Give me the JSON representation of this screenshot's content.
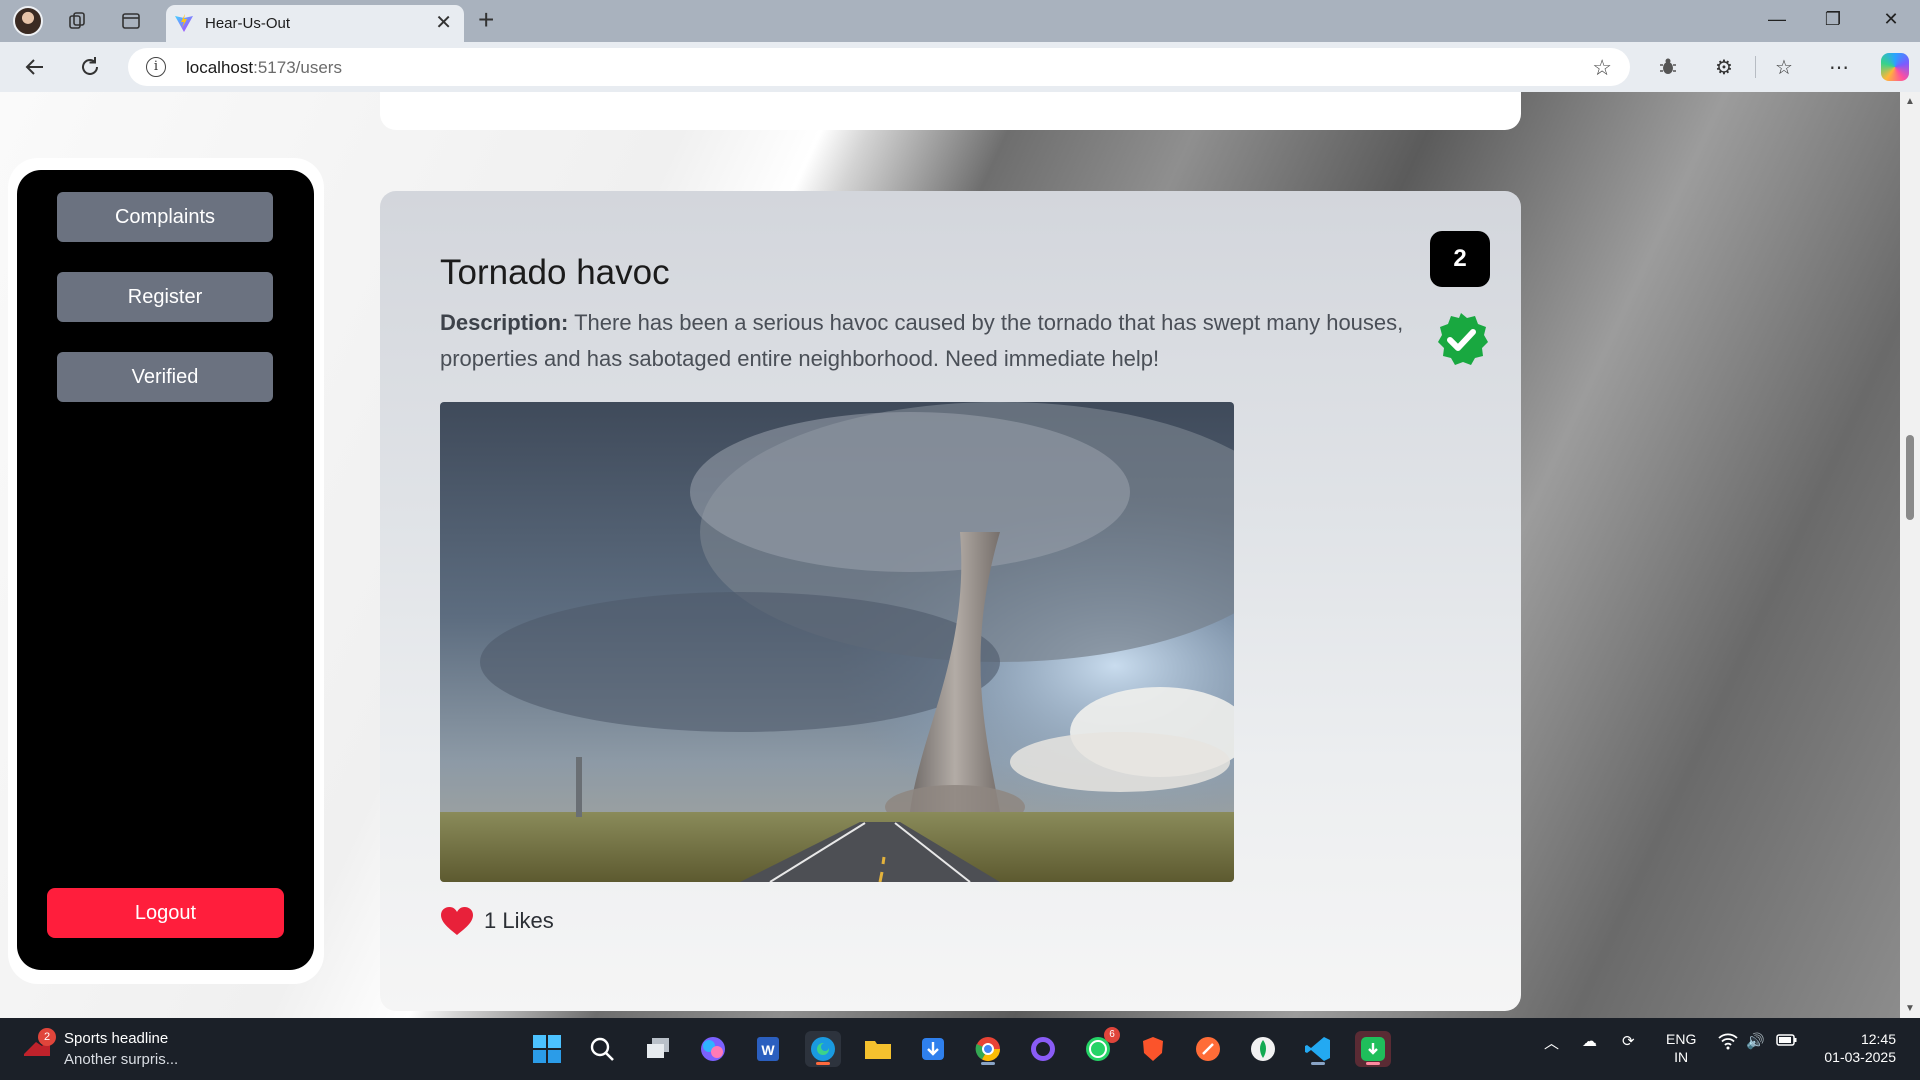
{
  "browser": {
    "tab_title": "Hear-Us-Out",
    "url_host": "localhost",
    "url_path": ":5173/users"
  },
  "sidebar": {
    "items": [
      {
        "label": "Complaints"
      },
      {
        "label": "Register"
      },
      {
        "label": "Verified"
      }
    ],
    "logout_label": "Logout"
  },
  "complaint": {
    "title": "Tornado havoc",
    "count": "2",
    "description_label": "Description:",
    "description": "There has been a serious havoc caused by the tornado that has swept many houses, properties and has sabotaged entire neighborhood. Need immediate help!",
    "likes": "1 Likes",
    "verified": true,
    "image": "tornado over highway photo"
  },
  "colors": {
    "logout": "#ff1e3c",
    "sidebar_button": "#6b7280",
    "verified": "#19a840",
    "heart": "#e8213a"
  },
  "taskbar": {
    "news_badge": "2",
    "news_title": "Sports headline",
    "news_sub": "Another surpris...",
    "whatsapp_badge": "6",
    "lang_line1": "ENG",
    "lang_line2": "IN",
    "time": "12:45",
    "date": "01-03-2025"
  }
}
